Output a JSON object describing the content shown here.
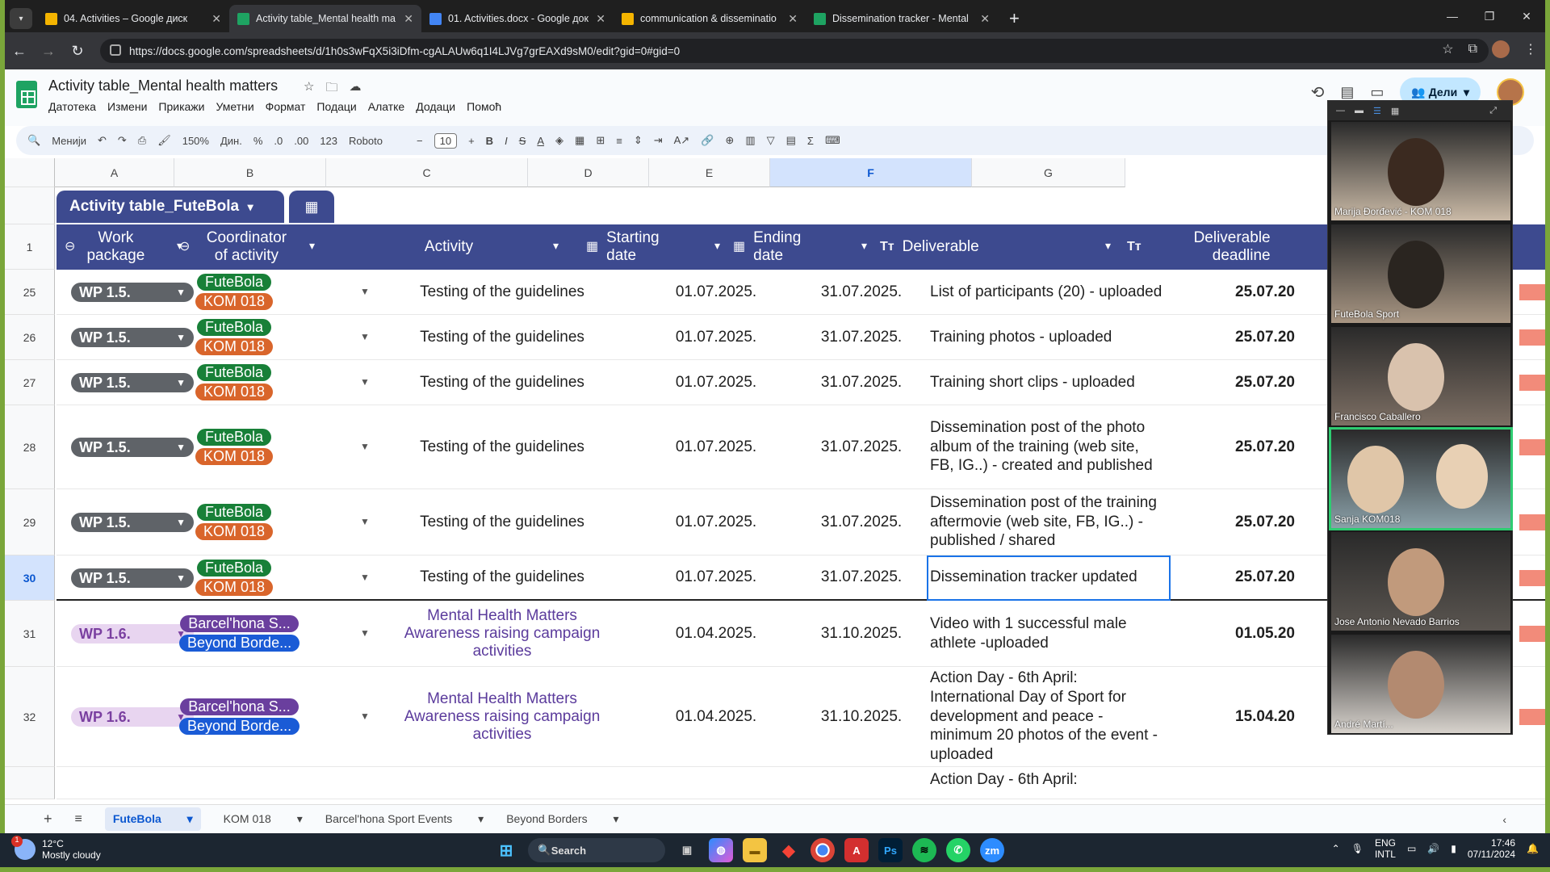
{
  "browser": {
    "tabs": [
      {
        "title": "04. Activities – Google диск",
        "color": "#f4b400"
      },
      {
        "title": "Activity table_Mental health ma",
        "color": "#1ea362",
        "active": true
      },
      {
        "title": "01. Activities.docx - Google док",
        "color": "#4285f4"
      },
      {
        "title": "communication & disseminatio",
        "color": "#f4b400"
      },
      {
        "title": "Dissemination tracker - Mental",
        "color": "#1ea362"
      }
    ],
    "url": "https://docs.google.com/spreadsheets/d/1h0s3wFqX5i3iDfm-cgALAUw6q1I4LJVg7grEAXd9sM0/edit?gid=0#gid=0"
  },
  "sheet": {
    "title": "Activity table_Mental health matters",
    "menus": [
      "Датотека",
      "Измени",
      "Прикажи",
      "Уметни",
      "Формат",
      "Подаци",
      "Алатке",
      "Додаци",
      "Помоћ"
    ],
    "share_label": "Дели",
    "toolbar": {
      "search": "Менији",
      "zoom": "150%",
      "currency": "Дин.",
      "percent": "%",
      "dec_less": ".0",
      "dec_more": ".00",
      "number": "123",
      "font": "Roboto",
      "font_size": "10"
    },
    "columns": [
      "A",
      "B",
      "C",
      "D",
      "E",
      "F",
      "G"
    ],
    "table_name": "Activity table_FuteBola",
    "headers": {
      "wp": "Work package",
      "coord": "Coordinator of activity",
      "activity": "Activity",
      "start": "Starting date",
      "end": "Ending date",
      "deliverable": "Deliverable",
      "deadline": "Deliverable deadline"
    },
    "header_row_num": "1",
    "rows": [
      {
        "num": "25",
        "wp": "WP 1.5.",
        "c1": "FuteBola",
        "c2": "KOM 018",
        "activity": "Testing of the guidelines",
        "start": "01.07.2025.",
        "end": "31.07.2025.",
        "deliverable": "List of participants (20) - uploaded",
        "deadline": "25.07.20"
      },
      {
        "num": "26",
        "wp": "WP 1.5.",
        "c1": "FuteBola",
        "c2": "KOM 018",
        "activity": "Testing of the guidelines",
        "start": "01.07.2025.",
        "end": "31.07.2025.",
        "deliverable": "Training photos - uploaded",
        "deadline": "25.07.20"
      },
      {
        "num": "27",
        "wp": "WP 1.5.",
        "c1": "FuteBola",
        "c2": "KOM 018",
        "activity": "Testing of the guidelines",
        "start": "01.07.2025.",
        "end": "31.07.2025.",
        "deliverable": "Training short clips - uploaded",
        "deadline": "25.07.20"
      },
      {
        "num": "28",
        "wp": "WP 1.5.",
        "c1": "FuteBola",
        "c2": "KOM 018",
        "activity": "Testing of the guidelines",
        "start": "01.07.2025.",
        "end": "31.07.2025.",
        "deliverable": "Dissemination post of the photo album of the training (web site, FB, IG..) - created and published",
        "deadline": "25.07.20"
      },
      {
        "num": "29",
        "wp": "WP 1.5.",
        "c1": "FuteBola",
        "c2": "KOM 018",
        "activity": "Testing of the guidelines",
        "start": "01.07.2025.",
        "end": "31.07.2025.",
        "deliverable": "Dissemination post of the training  aftermovie (web site, FB, IG..)  - published / shared",
        "deadline": "25.07.20"
      },
      {
        "num": "30",
        "wp": "WP 1.5.",
        "c1": "FuteBola",
        "c2": "KOM 018",
        "activity": "Testing of the guidelines",
        "start": "01.07.2025.",
        "end": "31.07.2025.",
        "deliverable": "Dissemination tracker updated",
        "deadline": "25.07.20"
      },
      {
        "num": "31",
        "wp": "WP 1.6.",
        "c1": "Barcel'hona S...",
        "c2": "Beyond Borde...",
        "activity": "Mental Health Matters Awareness raising campaign activities",
        "start": "01.04.2025.",
        "end": "31.10.2025.",
        "deliverable": "Video with 1 successful male athlete -uploaded",
        "deadline": "01.05.20"
      },
      {
        "num": "32",
        "wp": "WP 1.6.",
        "c1": "Barcel'hona S...",
        "c2": "Beyond Borde...",
        "activity": "Mental Health Matters Awareness raising campaign activities",
        "start": "01.04.2025.",
        "end": "31.10.2025.",
        "deliverable": "Action Day - 6th April: International Day of Sport for development and peace - minimum 20 photos of the event - uploaded",
        "deadline": "15.04.20"
      },
      {
        "num": "",
        "wp": "",
        "c1": "",
        "c2": "",
        "activity": "",
        "start": "",
        "end": "",
        "deliverable": "Action Day - 6th April:",
        "deadline": ""
      }
    ],
    "sheet_tabs": [
      "FuteBola",
      "KOM 018",
      "Barcel'hona Sport Events",
      "Beyond Borders"
    ]
  },
  "zoom": {
    "participants": [
      "Marija Đorđević - KOM 018",
      "FuteBola Sport",
      "Francisco Caballero",
      "Sanja KOM018",
      "Jose Antonio Nevado Barrios",
      "André Martí..."
    ]
  },
  "taskbar": {
    "weather_temp": "12°C",
    "weather_text": "Mostly cloudy",
    "search": "Search",
    "lang": "ENG",
    "lang2": "INTL",
    "time": "17:46",
    "date": "07/11/2024",
    "notif_badge": "1"
  }
}
